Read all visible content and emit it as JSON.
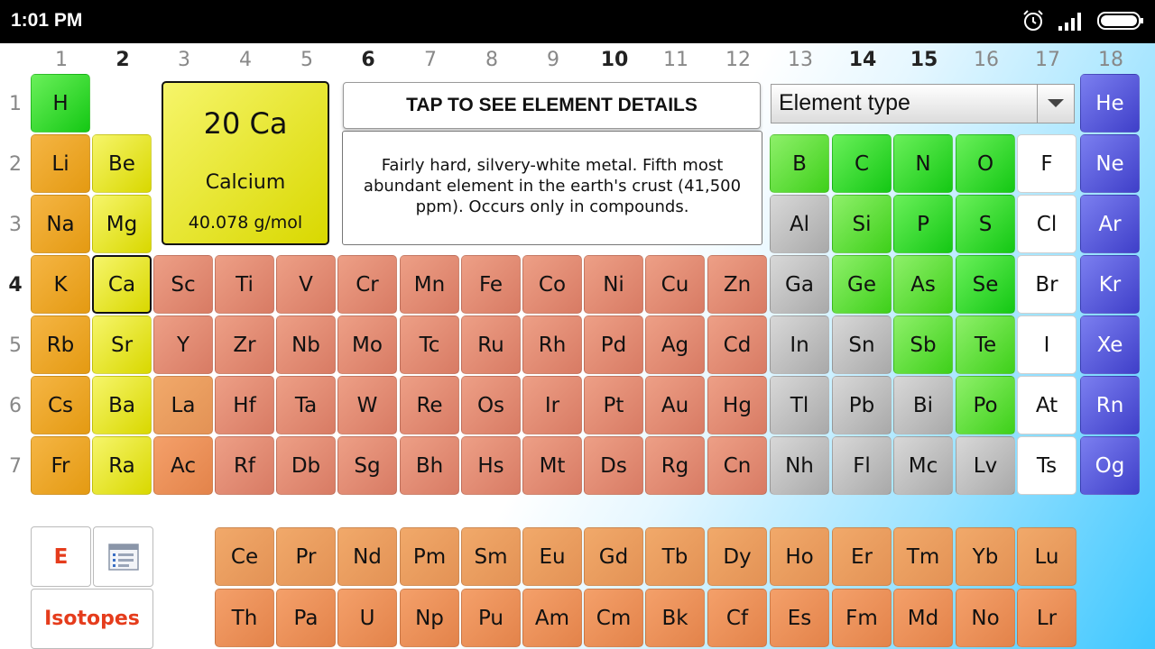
{
  "status_bar": {
    "time": "1:01 PM",
    "icons": [
      "alarm-icon",
      "signal-icon",
      "battery-icon"
    ]
  },
  "columns": [
    "1",
    "2",
    "3",
    "4",
    "5",
    "6",
    "7",
    "8",
    "9",
    "10",
    "11",
    "12",
    "13",
    "14",
    "15",
    "16",
    "17",
    "18"
  ],
  "rows": [
    "1",
    "2",
    "3",
    "4",
    "5",
    "6",
    "7"
  ],
  "selected_element": {
    "header": "20 Ca",
    "name": "Calcium",
    "mass": "40.078 g/mol"
  },
  "tap_button": "TAP TO SEE ELEMENT DETAILS",
  "description": "Fairly hard, silvery-white metal. Fifth most abundant element in the earth's crust (41,500 ppm). Occurs only in compounds.",
  "element_type_select": "Element type",
  "elements": {
    "H": "H",
    "He": "He",
    "Li": "Li",
    "Be": "Be",
    "B": "B",
    "C": "C",
    "N": "N",
    "O": "O",
    "F": "F",
    "Ne": "Ne",
    "Na": "Na",
    "Mg": "Mg",
    "Al": "Al",
    "Si": "Si",
    "P": "P",
    "S": "S",
    "Cl": "Cl",
    "Ar": "Ar",
    "K": "K",
    "Ca": "Ca",
    "Sc": "Sc",
    "Ti": "Ti",
    "V": "V",
    "Cr": "Cr",
    "Mn": "Mn",
    "Fe": "Fe",
    "Co": "Co",
    "Ni": "Ni",
    "Cu": "Cu",
    "Zn": "Zn",
    "Ga": "Ga",
    "Ge": "Ge",
    "As": "As",
    "Se": "Se",
    "Br": "Br",
    "Kr": "Kr",
    "Rb": "Rb",
    "Sr": "Sr",
    "Y": "Y",
    "Zr": "Zr",
    "Nb": "Nb",
    "Mo": "Mo",
    "Tc": "Tc",
    "Ru": "Ru",
    "Rh": "Rh",
    "Pd": "Pd",
    "Ag": "Ag",
    "Cd": "Cd",
    "In": "In",
    "Sn": "Sn",
    "Sb": "Sb",
    "Te": "Te",
    "I": "I",
    "Xe": "Xe",
    "Cs": "Cs",
    "Ba": "Ba",
    "La": "La",
    "Hf": "Hf",
    "Ta": "Ta",
    "W": "W",
    "Re": "Re",
    "Os": "Os",
    "Ir": "Ir",
    "Pt": "Pt",
    "Au": "Au",
    "Hg": "Hg",
    "Tl": "Tl",
    "Pb": "Pb",
    "Bi": "Bi",
    "Po": "Po",
    "At": "At",
    "Rn": "Rn",
    "Fr": "Fr",
    "Ra": "Ra",
    "Ac": "Ac",
    "Rf": "Rf",
    "Db": "Db",
    "Sg": "Sg",
    "Bh": "Bh",
    "Hs": "Hs",
    "Mt": "Mt",
    "Ds": "Ds",
    "Rg": "Rg",
    "Cn": "Cn",
    "Nh": "Nh",
    "Fl": "Fl",
    "Mc": "Mc",
    "Lv": "Lv",
    "Ts": "Ts",
    "Og": "Og",
    "Ce": "Ce",
    "Pr": "Pr",
    "Nd": "Nd",
    "Pm": "Pm",
    "Sm": "Sm",
    "Eu": "Eu",
    "Gd": "Gd",
    "Tb": "Tb",
    "Dy": "Dy",
    "Ho": "Ho",
    "Er": "Er",
    "Tm": "Tm",
    "Yb": "Yb",
    "Lu": "Lu",
    "Th": "Th",
    "Pa": "Pa",
    "U": "U",
    "Np": "Np",
    "Pu": "Pu",
    "Am": "Am",
    "Cm": "Cm",
    "Bk": "Bk",
    "Cf": "Cf",
    "Es": "Es",
    "Fm": "Fm",
    "Md": "Md",
    "No": "No",
    "Lr": "Lr"
  },
  "buttons": {
    "energy": "E",
    "list": "list-icon",
    "isotopes": "Isotopes"
  },
  "colors": {
    "alkali": "#e49a12",
    "alkaline_earth": "#d9d800",
    "transition": "#d87b64",
    "poor_metal": "#a9a9a9",
    "nonmetal": "#14c814",
    "halogen": "#ffffff",
    "noble_gas": "#3f3fc9",
    "accent_red": "#e53c1c"
  }
}
